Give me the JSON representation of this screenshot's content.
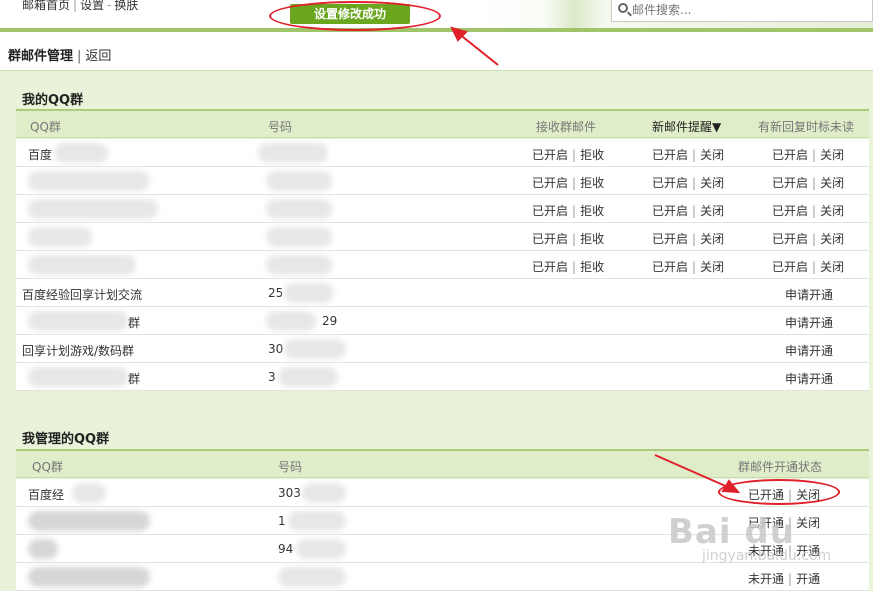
{
  "topbar": {
    "nav_items": [
      "邮箱首页",
      "设置",
      "换肤"
    ],
    "success_message": "设置修改成功",
    "search_placeholder": "邮件搜索..."
  },
  "page_header": {
    "title": "群邮件管理",
    "back_link": "返回"
  },
  "my_groups": {
    "section_title": "我的QQ群",
    "columns": {
      "group": "QQ群",
      "number": "号码",
      "receive": "接收群邮件",
      "new_mail_alert": "新邮件提醒▼",
      "reply_unread": "有新回复时标未读"
    },
    "toggle_labels": {
      "opened": "已开启",
      "reject": "拒收",
      "close": "关闭"
    },
    "apply_label": "申请开通",
    "rows": [
      {
        "name": "百度",
        "number": "",
        "enabled": true
      },
      {
        "name": "",
        "number": "",
        "enabled": true
      },
      {
        "name": "",
        "number": "",
        "enabled": true
      },
      {
        "name": "",
        "number": "",
        "enabled": true
      },
      {
        "name": "",
        "number": "",
        "enabled": true
      },
      {
        "name": "百度经验回享计划交流",
        "number": "25",
        "enabled": false
      },
      {
        "name": "群",
        "number": "29",
        "enabled": false
      },
      {
        "name": "回享计划游戏/数码群",
        "number": "30",
        "enabled": false
      },
      {
        "name": "群",
        "number": "3",
        "enabled": false
      }
    ]
  },
  "managed_groups": {
    "section_title": "我管理的QQ群",
    "columns": {
      "group": "QQ群",
      "number": "号码",
      "status": "群邮件开通状态"
    },
    "rows": [
      {
        "name": "百度经",
        "number": "303",
        "status_a": "已开通",
        "status_b": "关闭"
      },
      {
        "name": "",
        "number": "1",
        "status_a": "已开通",
        "status_b": "关闭"
      },
      {
        "name": "",
        "number": "94",
        "status_a": "未开通",
        "status_b": "开通"
      },
      {
        "name": "",
        "number": "",
        "status_a": "未开通",
        "status_b": "开通"
      }
    ]
  },
  "watermark": {
    "logo": "Bai du",
    "sub": "jingyan.baidu.com"
  },
  "colors": {
    "accent_green": "#6aa61e",
    "content_bg": "#e9f3da",
    "annotation_red": "#e0202a"
  }
}
